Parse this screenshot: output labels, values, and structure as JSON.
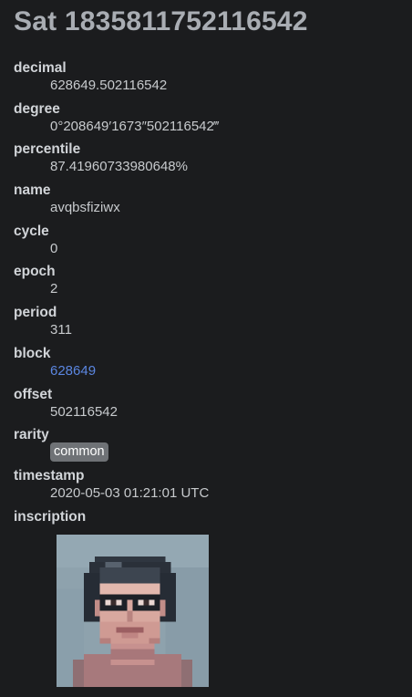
{
  "title": "Sat 1835811752116542",
  "fields": [
    {
      "label": "decimal",
      "value": "628649.502116542"
    },
    {
      "label": "degree",
      "value": "0°208649′1673″502116542‴"
    },
    {
      "label": "percentile",
      "value": "87.41960733980648%"
    },
    {
      "label": "name",
      "value": "avqbsfiziwx"
    },
    {
      "label": "cycle",
      "value": "0"
    },
    {
      "label": "epoch",
      "value": "2"
    },
    {
      "label": "period",
      "value": "311"
    },
    {
      "label": "block",
      "value": "628649"
    },
    {
      "label": "offset",
      "value": "502116542"
    },
    {
      "label": "rarity",
      "value": "common"
    },
    {
      "label": "timestamp",
      "value": "2020-05-03 01:21:01 UTC"
    },
    {
      "label": "inscription"
    }
  ],
  "colors": {
    "background": "#1b1c1e",
    "link": "#5b86e0",
    "badge": "#6f7276"
  }
}
